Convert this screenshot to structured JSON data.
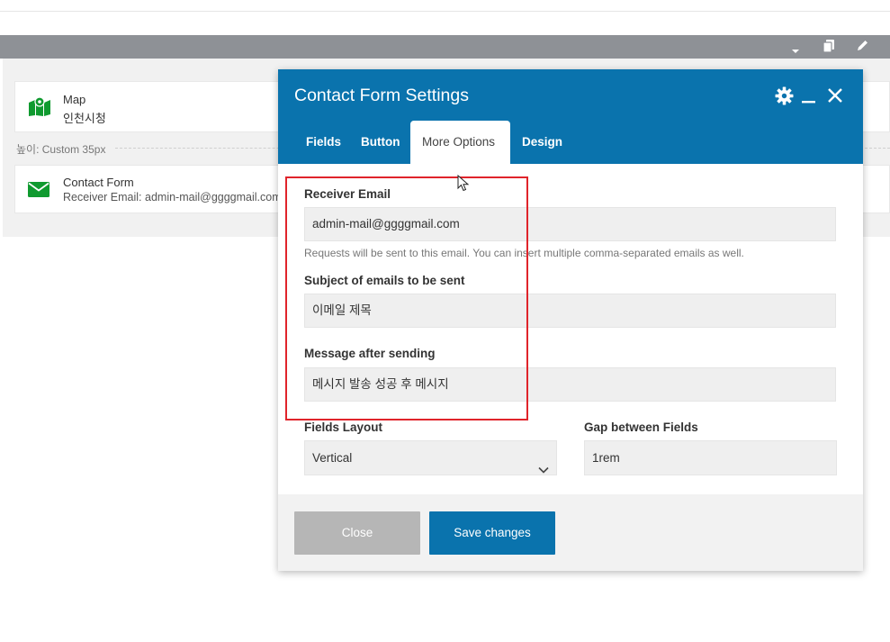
{
  "admin_bar": {
    "dropdown_icon": "caret-down-icon",
    "copy_icon": "copy-icon",
    "edit_icon": "pencil-icon"
  },
  "blocks": {
    "map": {
      "icon": "map-icon",
      "title": "Map",
      "subtitle": "인천시청"
    },
    "spacer": {
      "label": "높이: Custom  35px"
    },
    "contact_form": {
      "icon": "envelope-icon",
      "title": "Contact Form",
      "subtitle": "Receiver Email: admin-mail@ggggmail.com"
    }
  },
  "modal": {
    "title": "Contact Form Settings",
    "controls": {
      "settings_icon": "gear-icon",
      "minimize_icon": "minimize-icon",
      "close_icon": "close-icon"
    },
    "tabs": [
      {
        "label": "Fields",
        "active": false
      },
      {
        "label": "Button",
        "active": false
      },
      {
        "label": "More Options",
        "active": true
      },
      {
        "label": "Design",
        "active": false
      }
    ],
    "fields": {
      "receiver_email": {
        "label": "Receiver Email",
        "value": "admin-mail@ggggmail.com",
        "help": "Requests will be sent to this email. You can insert multiple comma-separated emails as well."
      },
      "subject": {
        "label": "Subject of emails to be sent",
        "value": "이메일 제목"
      },
      "message_after": {
        "label": "Message after sending",
        "value": "메시지 발송 성공 후 메시지"
      },
      "fields_layout": {
        "label": "Fields Layout",
        "value": "Vertical"
      },
      "gap": {
        "label": "Gap between Fields",
        "value": "1rem"
      }
    },
    "footer": {
      "close_label": "Close",
      "save_label": "Save changes"
    }
  },
  "colors": {
    "modal_header": "#0a73ad",
    "save_button": "#0a73ad",
    "close_button": "#b6b6b6",
    "highlight_box": "#e0242b",
    "block_icon": "#0f9a2f",
    "admin_bar": "#8e9196"
  }
}
